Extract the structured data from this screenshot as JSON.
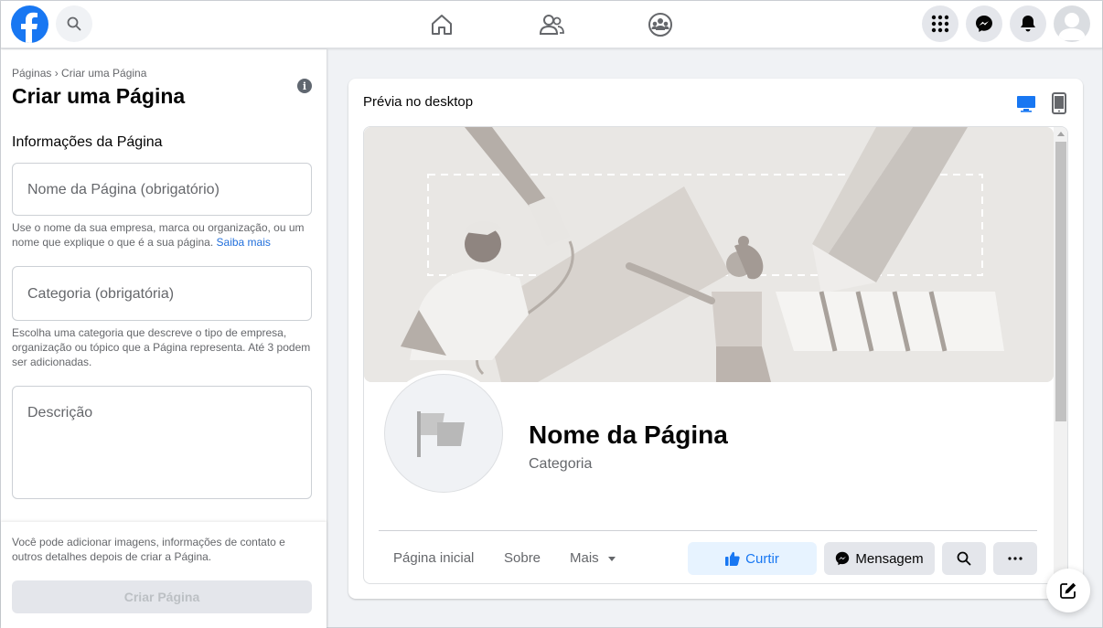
{
  "icons": {
    "logo": "facebook-logo",
    "search": "search-icon",
    "home": "home-icon",
    "friends": "friends-icon",
    "groups": "groups-icon",
    "menu": "grid-menu-icon",
    "messenger": "messenger-icon",
    "notifications": "bell-icon",
    "account": "avatar"
  },
  "sidebar": {
    "breadcrumb": "Páginas › Criar uma Página",
    "title": "Criar uma Página",
    "section_title": "Informações da Página",
    "name_placeholder": "Nome da Página (obrigatório)",
    "name_help": "Use o nome da sua empresa, marca ou organização, ou um nome que explique o que é a sua página.",
    "name_help_link": "Saiba mais",
    "category_placeholder": "Categoria (obrigatória)",
    "category_help": "Escolha uma categoria que descreve o tipo de empresa, organização ou tópico que a Página representa. Até 3 podem ser adicionadas.",
    "description_placeholder": "Descrição",
    "bottom_note": "Você pode adicionar imagens, informações de contato e outros detalhes depois de criar a Página.",
    "create_button": "Criar Página"
  },
  "preview": {
    "title": "Prévia no desktop",
    "page_name": "Nome da Página",
    "page_category": "Categoria",
    "tabs": [
      "Página inicial",
      "Sobre",
      "Mais"
    ],
    "like_button": "Curtir",
    "message_button": "Mensagem"
  },
  "colors": {
    "brand": "#1877f2",
    "like_bg": "#e7f3ff"
  }
}
